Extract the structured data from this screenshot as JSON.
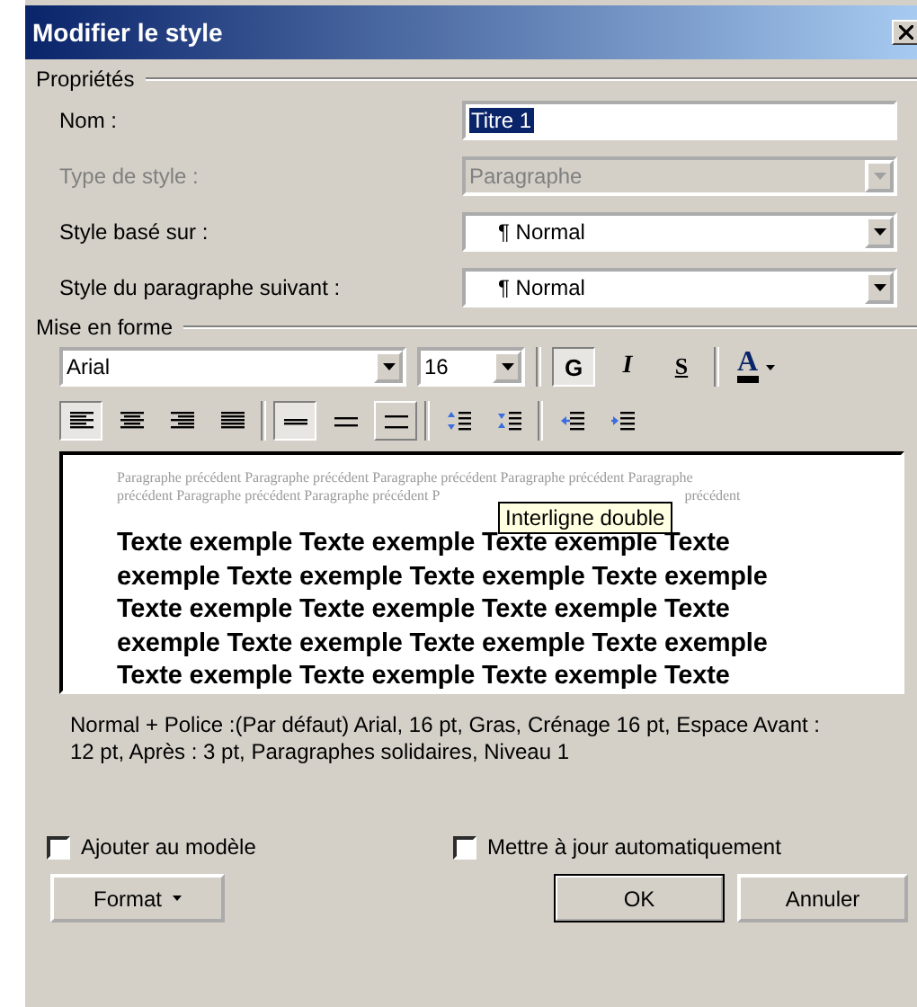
{
  "window": {
    "title": "Modifier le style"
  },
  "properties": {
    "legend": "Propriétés",
    "fields": [
      {
        "label": "Nom :",
        "kind": "text",
        "value": "Titre 1",
        "disabled": false
      },
      {
        "label": "Type de style :",
        "kind": "dropdown",
        "value": "Paragraphe",
        "disabled": true
      },
      {
        "label": "Style basé sur :",
        "kind": "dropdown",
        "value": "¶ Normal",
        "disabled": false
      },
      {
        "label": "Style du paragraphe suivant :",
        "kind": "dropdown",
        "value": "¶ Normal",
        "disabled": false
      }
    ]
  },
  "formatting": {
    "legend": "Mise en forme",
    "font": "Arial",
    "size": "16",
    "styles": [
      {
        "label": "G",
        "kind": "bold",
        "selected": true
      },
      {
        "label": "I",
        "kind": "italic",
        "selected": false
      },
      {
        "label": "S",
        "kind": "underline",
        "selected": false
      }
    ],
    "font_color": {
      "label": "A"
    },
    "alignment": [
      {
        "kind": "left",
        "selected": true
      },
      {
        "kind": "center",
        "selected": false
      },
      {
        "kind": "right",
        "selected": false
      },
      {
        "kind": "justify",
        "selected": false
      }
    ],
    "spacing": [
      {
        "kind": "single",
        "selected": true
      },
      {
        "kind": "one-half",
        "selected": false
      },
      {
        "kind": "double",
        "selected": false,
        "hovered": true
      }
    ],
    "paragraph_spacing": [
      {
        "kind": "increase"
      },
      {
        "kind": "decrease"
      }
    ],
    "indent": [
      {
        "kind": "decrease"
      },
      {
        "kind": "increase"
      }
    ],
    "tooltip": "Interligne double"
  },
  "preview": {
    "previous_lines": [
      "Paragraphe précédent Paragraphe précédent Paragraphe précédent Paragraphe précédent Paragraphe",
      "précédent Paragraphe précédent Paragraphe précédent P",
      "précédent"
    ],
    "sample_lines": [
      "Texte exemple Texte exemple Texte exemple Texte",
      "exemple Texte exemple Texte exemple Texte exemple",
      "Texte exemple Texte exemple Texte exemple Texte",
      "exemple Texte exemple Texte exemple Texte exemple",
      "Texte exemple Texte exemple Texte exemple Texte"
    ]
  },
  "description": "Normal + Police :(Par défaut) Arial, 16 pt, Gras, Crénage 16 pt, Espace Avant : 12 pt, Après : 3 pt, Paragraphes solidaires, Niveau 1",
  "checkboxes": [
    {
      "label": "Ajouter au modèle",
      "checked": false
    },
    {
      "label": "Mettre à jour automatiquement",
      "checked": false
    }
  ],
  "buttons": [
    {
      "label": "Format",
      "kind": "menu"
    },
    {
      "label": "OK",
      "kind": "default"
    },
    {
      "label": "Annuler",
      "kind": "normal"
    }
  ]
}
